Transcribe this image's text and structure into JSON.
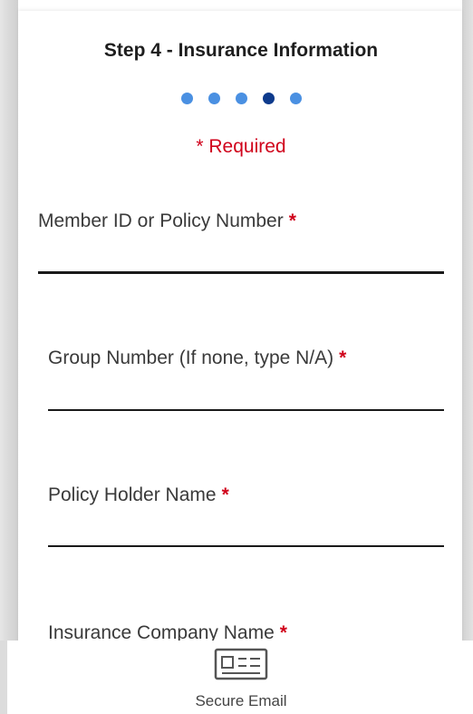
{
  "form": {
    "title": "Step 4 - Insurance Information",
    "steps": {
      "total": 5,
      "current": 4
    },
    "required_note": "* Required",
    "fields": [
      {
        "label": "Member ID or Policy Number",
        "required_mark": "*"
      },
      {
        "label": "Group Number (If none, type N/A)",
        "required_mark": "*"
      },
      {
        "label": "Policy Holder Name",
        "required_mark": "*"
      },
      {
        "label": "Insurance Company Name",
        "required_mark": "*"
      }
    ]
  },
  "footer": {
    "icon": "id-card-icon",
    "label": "Secure Email"
  },
  "colors": {
    "required": "#d0021b",
    "step_dot": "#4a90e2",
    "step_dot_active": "#0d3a8c"
  }
}
